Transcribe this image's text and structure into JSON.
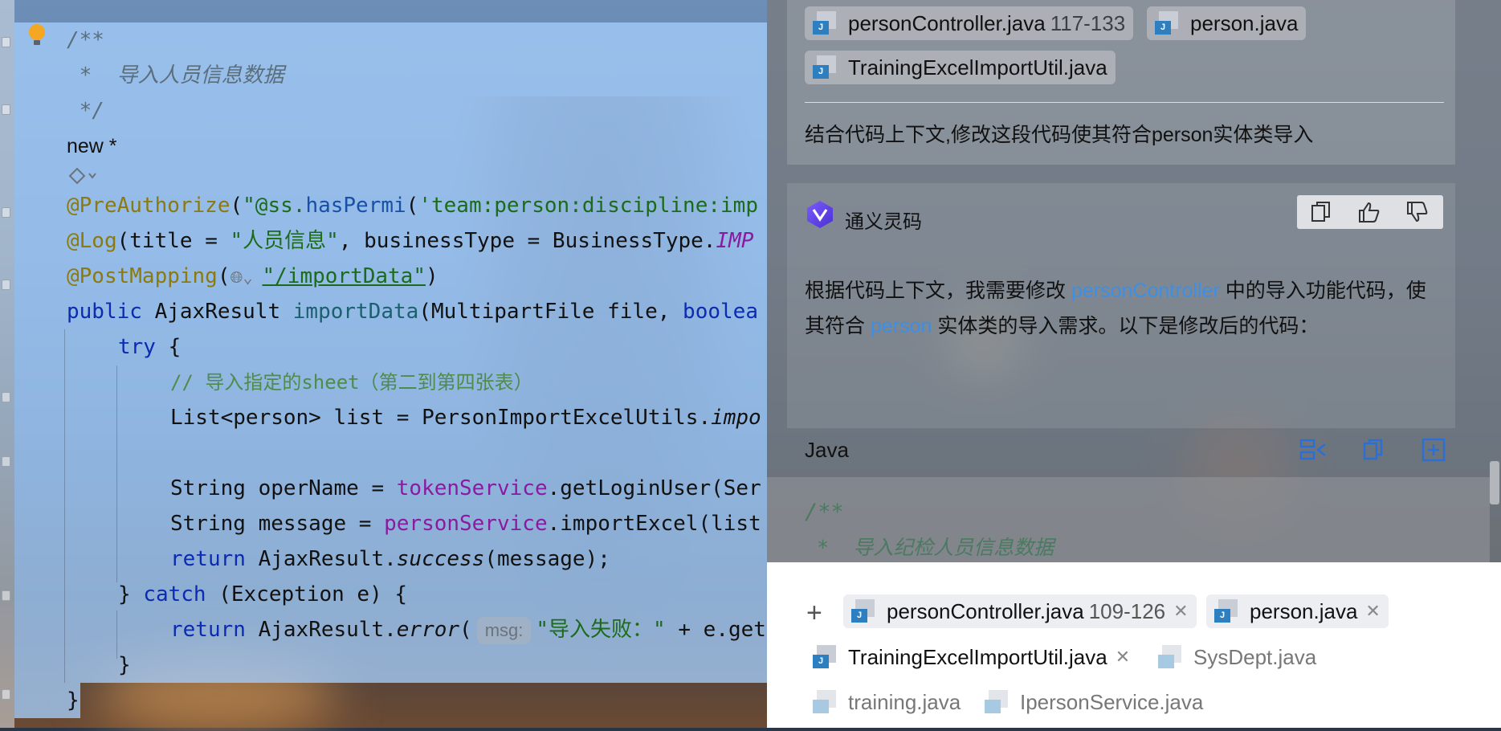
{
  "editor": {
    "lines": {
      "l1": "/**",
      "l2": " *  导入人员信息数据",
      "l3": " */",
      "new_marker": "new *",
      "l5_ann": "@PreAuthorize",
      "l5_p1": "(",
      "l5_str": "\"@ss.",
      "l5_m": "hasPermi",
      "l5_p2": "(",
      "l5_str2": "'team:person:discipline:imp",
      "l6_ann": "@Log",
      "l6_a": "(title = ",
      "l6_str": "\"人员信息\"",
      "l6_b": ", businessType = BusinessType.",
      "l6_c": "IMP",
      "l7_ann": "@PostMapping",
      "l7_a": "(",
      "l7_str": "\"/importData\"",
      "l7_b": ")",
      "l8_kw": "public",
      "l8_a": " AjaxResult ",
      "l8_m": "importData",
      "l8_b": "(MultipartFile file, ",
      "l8_kw2": "boolea",
      "l9_kw": "try",
      "l9_a": " {",
      "l10_cmt": "// 导入指定的sheet（第二到第四张表）",
      "l11_a": "List<person> list = PersonImportExcelUtils.",
      "l11_i": "impo",
      "l13_a": "String operName = ",
      "l13_f": "tokenService",
      "l13_b": ".getLoginUser(Ser",
      "l14_a": "String message = ",
      "l14_f": "personService",
      "l14_b": ".importExcel(list",
      "l15_kw": "return",
      "l15_a": " AjaxResult.",
      "l15_i": "success",
      "l15_b": "(message);",
      "l16_a": "} ",
      "l16_kw": "catch",
      "l16_b": " (Exception e) {",
      "l17_kw": "return",
      "l17_a": " AjaxResult.",
      "l17_i": "error",
      "l17_b": "(",
      "l17_hint": "msg:",
      "l17_str": "\"导入失败：\"",
      "l17_c": " + e.get",
      "l18": "}",
      "l19": "}"
    }
  },
  "chat": {
    "question": {
      "context_chips": [
        {
          "name": "personController.java",
          "range": "117-133"
        },
        {
          "name": "person.java",
          "range": ""
        },
        {
          "name": "TrainingExcelImportUtil.java",
          "range": ""
        }
      ],
      "text": "结合代码上下文,修改这段代码使其符合person实体类导入"
    },
    "answer": {
      "bot_name": "通义灵码",
      "p1": "根据代码上下文，我需要修改 ",
      "link1": "personController",
      "p2": " 中的导入功能代码，使其符合 ",
      "link2": "person",
      "p3": " 实体类的导入需求。以下是修改后的代码：",
      "code_lang": "Java",
      "snippet_l1": "/**",
      "snippet_l2": " *  导入纪检人员信息数据"
    },
    "input": {
      "plus": "+",
      "chips": [
        {
          "name": "personController.java",
          "range": "109-126",
          "active": true
        },
        {
          "name": "person.java",
          "range": "",
          "active": true
        },
        {
          "name": "TrainingExcelImportUtil.java",
          "range": "",
          "active": true
        },
        {
          "name": "SysDept.java",
          "range": "",
          "active": false
        },
        {
          "name": "training.java",
          "range": "",
          "active": false
        },
        {
          "name": "IpersonService.java",
          "range": "",
          "active": false
        }
      ],
      "close_glyph": "✕"
    }
  },
  "icons": {
    "java_badge": "J"
  },
  "colors": {
    "accent": "#2d7fbf",
    "link": "#3d8fe6",
    "selection": "#a5cdfa"
  }
}
